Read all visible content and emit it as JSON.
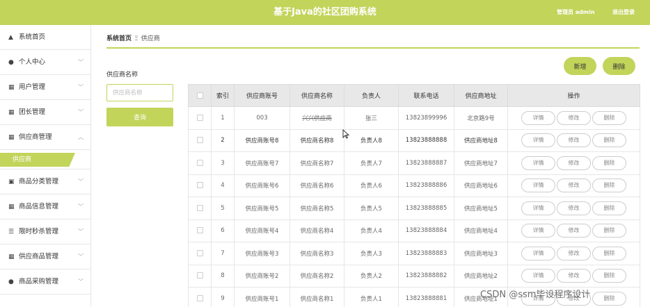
{
  "header": {
    "title": "基于Java的社区团购系统",
    "user": "管理员 admin",
    "logout": "退出登录"
  },
  "sidebar": {
    "items": [
      {
        "label": "系统首页",
        "icon": "home-icon",
        "glyph": "▲",
        "expandable": false
      },
      {
        "label": "个人中心",
        "icon": "user-icon",
        "glyph": "●",
        "expandable": true,
        "chevron": "﹀"
      },
      {
        "label": "用户管理",
        "icon": "grid-icon",
        "glyph": "▦",
        "expandable": true,
        "chevron": "﹀"
      },
      {
        "label": "团长管理",
        "icon": "grid-icon",
        "glyph": "▦",
        "expandable": true,
        "chevron": "﹀"
      },
      {
        "label": "供应商管理",
        "icon": "grid-icon",
        "glyph": "▦",
        "expandable": true,
        "chevron": "︿"
      },
      {
        "label": "商品分类管理",
        "icon": "clipboard-icon",
        "glyph": "▣",
        "expandable": true,
        "chevron": "﹀"
      },
      {
        "label": "商品信息管理",
        "icon": "grid-icon",
        "glyph": "▦",
        "expandable": true,
        "chevron": "﹀"
      },
      {
        "label": "限时秒杀管理",
        "icon": "list-icon",
        "glyph": "☰",
        "expandable": true,
        "chevron": "﹀"
      },
      {
        "label": "供应商品管理",
        "icon": "grid-icon",
        "glyph": "▦",
        "expandable": true,
        "chevron": "﹀"
      },
      {
        "label": "商品采购管理",
        "icon": "user-icon",
        "glyph": "●",
        "expandable": true,
        "chevron": "﹀"
      }
    ],
    "sub_active": "供应商"
  },
  "breadcrumb": {
    "home": "系统首页",
    "sep": "Ξ",
    "current": "供应商"
  },
  "filter": {
    "label": "供应商名称",
    "placeholder": "供应商名称",
    "query": "查询"
  },
  "actions": {
    "add": "新增",
    "delete": "删除"
  },
  "table": {
    "headers": [
      "索引",
      "供应商账号",
      "供应商名称",
      "负责人",
      "联系电话",
      "供应商地址",
      "操作"
    ],
    "row_actions": {
      "detail": "详情",
      "edit": "修改",
      "delete": "删除"
    },
    "rows": [
      {
        "index": "1",
        "account": "003",
        "name": "兴兴供应商",
        "manager": "张三",
        "phone": "13823899996",
        "address": "北京路9号"
      },
      {
        "index": "2",
        "account": "供应商账号8",
        "name": "供应商名称8",
        "manager": "负责人8",
        "phone": "13823888888",
        "address": "供应商地址8"
      },
      {
        "index": "3",
        "account": "供应商账号7",
        "name": "供应商名称7",
        "manager": "负责人7",
        "phone": "13823888887",
        "address": "供应商地址7"
      },
      {
        "index": "4",
        "account": "供应商账号6",
        "name": "供应商名称6",
        "manager": "负责人6",
        "phone": "13823888886",
        "address": "供应商地址6"
      },
      {
        "index": "5",
        "account": "供应商账号5",
        "name": "供应商名称5",
        "manager": "负责人5",
        "phone": "13823888885",
        "address": "供应商地址5"
      },
      {
        "index": "6",
        "account": "供应商账号4",
        "name": "供应商名称4",
        "manager": "负责人4",
        "phone": "13823888884",
        "address": "供应商地址4"
      },
      {
        "index": "7",
        "account": "供应商账号3",
        "name": "供应商名称3",
        "manager": "负责人3",
        "phone": "13823888883",
        "address": "供应商地址3"
      },
      {
        "index": "8",
        "account": "供应商账号2",
        "name": "供应商名称2",
        "manager": "负责人2",
        "phone": "13823888882",
        "address": "供应商地址2"
      },
      {
        "index": "9",
        "account": "供应商账号1",
        "name": "供应商名称1",
        "manager": "负责人1",
        "phone": "13823888881",
        "address": "供应商地址1"
      }
    ]
  },
  "watermark": "CSDN @ssm毕设程序设计",
  "colors": {
    "accent": "#c2d45a",
    "header_bg": "#e8e8e8",
    "border": "#e6e6e6"
  }
}
